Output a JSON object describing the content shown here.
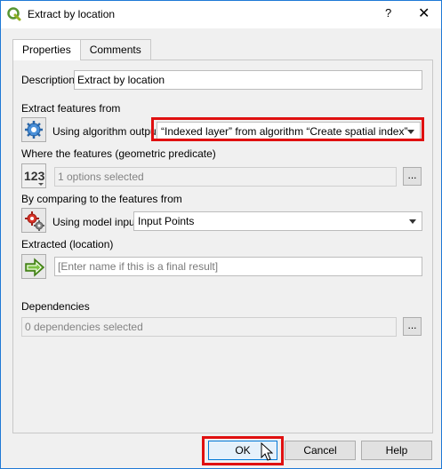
{
  "window": {
    "title": "Extract by location",
    "help_glyph": "?",
    "close_glyph": "✕"
  },
  "tabs": [
    {
      "label": "Properties"
    },
    {
      "label": "Comments"
    }
  ],
  "description": {
    "label": "Description",
    "value": "Extract by location"
  },
  "extract_from": {
    "section_label": "Extract features from",
    "mode_label": "Using algorithm output",
    "value": "“Indexed layer” from algorithm “Create spatial index”"
  },
  "predicate": {
    "section_label": "Where the features (geometric predicate)",
    "placeholder": "1 options selected",
    "button": "..."
  },
  "compare": {
    "section_label": "By comparing to the features from",
    "mode_label": "Using model input",
    "value": "Input Points"
  },
  "extracted": {
    "section_label": "Extracted (location)",
    "placeholder": "[Enter name if this is a final result]"
  },
  "dependencies": {
    "section_label": "Dependencies",
    "placeholder": "0 dependencies selected",
    "button": "..."
  },
  "buttons": {
    "ok": "OK",
    "cancel": "Cancel",
    "help": "Help"
  },
  "colors": {
    "highlight": "#e01010",
    "accent": "#0078d7"
  },
  "icons": [
    "qgis-logo-icon",
    "gear-icon",
    "number-123-icon",
    "model-input-gears-icon",
    "output-arrow-icon",
    "dropdown-arrow-icon",
    "mouse-cursor-icon"
  ]
}
